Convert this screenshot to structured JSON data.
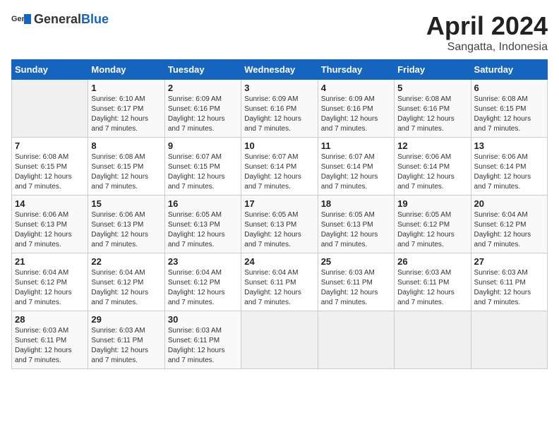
{
  "header": {
    "logo_general": "General",
    "logo_blue": "Blue",
    "month_title": "April 2024",
    "location": "Sangatta, Indonesia"
  },
  "calendar": {
    "days_of_week": [
      "Sunday",
      "Monday",
      "Tuesday",
      "Wednesday",
      "Thursday",
      "Friday",
      "Saturday"
    ],
    "weeks": [
      [
        {
          "day": null,
          "info": null
        },
        {
          "day": "1",
          "sunrise": "6:10 AM",
          "sunset": "6:17 PM",
          "daylight": "12 hours and 7 minutes."
        },
        {
          "day": "2",
          "sunrise": "6:09 AM",
          "sunset": "6:16 PM",
          "daylight": "12 hours and 7 minutes."
        },
        {
          "day": "3",
          "sunrise": "6:09 AM",
          "sunset": "6:16 PM",
          "daylight": "12 hours and 7 minutes."
        },
        {
          "day": "4",
          "sunrise": "6:09 AM",
          "sunset": "6:16 PM",
          "daylight": "12 hours and 7 minutes."
        },
        {
          "day": "5",
          "sunrise": "6:08 AM",
          "sunset": "6:16 PM",
          "daylight": "12 hours and 7 minutes."
        },
        {
          "day": "6",
          "sunrise": "6:08 AM",
          "sunset": "6:15 PM",
          "daylight": "12 hours and 7 minutes."
        }
      ],
      [
        {
          "day": "7",
          "sunrise": "6:08 AM",
          "sunset": "6:15 PM",
          "daylight": "12 hours and 7 minutes."
        },
        {
          "day": "8",
          "sunrise": "6:08 AM",
          "sunset": "6:15 PM",
          "daylight": "12 hours and 7 minutes."
        },
        {
          "day": "9",
          "sunrise": "6:07 AM",
          "sunset": "6:15 PM",
          "daylight": "12 hours and 7 minutes."
        },
        {
          "day": "10",
          "sunrise": "6:07 AM",
          "sunset": "6:14 PM",
          "daylight": "12 hours and 7 minutes."
        },
        {
          "day": "11",
          "sunrise": "6:07 AM",
          "sunset": "6:14 PM",
          "daylight": "12 hours and 7 minutes."
        },
        {
          "day": "12",
          "sunrise": "6:06 AM",
          "sunset": "6:14 PM",
          "daylight": "12 hours and 7 minutes."
        },
        {
          "day": "13",
          "sunrise": "6:06 AM",
          "sunset": "6:14 PM",
          "daylight": "12 hours and 7 minutes."
        }
      ],
      [
        {
          "day": "14",
          "sunrise": "6:06 AM",
          "sunset": "6:13 PM",
          "daylight": "12 hours and 7 minutes."
        },
        {
          "day": "15",
          "sunrise": "6:06 AM",
          "sunset": "6:13 PM",
          "daylight": "12 hours and 7 minutes."
        },
        {
          "day": "16",
          "sunrise": "6:05 AM",
          "sunset": "6:13 PM",
          "daylight": "12 hours and 7 minutes."
        },
        {
          "day": "17",
          "sunrise": "6:05 AM",
          "sunset": "6:13 PM",
          "daylight": "12 hours and 7 minutes."
        },
        {
          "day": "18",
          "sunrise": "6:05 AM",
          "sunset": "6:13 PM",
          "daylight": "12 hours and 7 minutes."
        },
        {
          "day": "19",
          "sunrise": "6:05 AM",
          "sunset": "6:12 PM",
          "daylight": "12 hours and 7 minutes."
        },
        {
          "day": "20",
          "sunrise": "6:04 AM",
          "sunset": "6:12 PM",
          "daylight": "12 hours and 7 minutes."
        }
      ],
      [
        {
          "day": "21",
          "sunrise": "6:04 AM",
          "sunset": "6:12 PM",
          "daylight": "12 hours and 7 minutes."
        },
        {
          "day": "22",
          "sunrise": "6:04 AM",
          "sunset": "6:12 PM",
          "daylight": "12 hours and 7 minutes."
        },
        {
          "day": "23",
          "sunrise": "6:04 AM",
          "sunset": "6:12 PM",
          "daylight": "12 hours and 7 minutes."
        },
        {
          "day": "24",
          "sunrise": "6:04 AM",
          "sunset": "6:11 PM",
          "daylight": "12 hours and 7 minutes."
        },
        {
          "day": "25",
          "sunrise": "6:03 AM",
          "sunset": "6:11 PM",
          "daylight": "12 hours and 7 minutes."
        },
        {
          "day": "26",
          "sunrise": "6:03 AM",
          "sunset": "6:11 PM",
          "daylight": "12 hours and 7 minutes."
        },
        {
          "day": "27",
          "sunrise": "6:03 AM",
          "sunset": "6:11 PM",
          "daylight": "12 hours and 7 minutes."
        }
      ],
      [
        {
          "day": "28",
          "sunrise": "6:03 AM",
          "sunset": "6:11 PM",
          "daylight": "12 hours and 7 minutes."
        },
        {
          "day": "29",
          "sunrise": "6:03 AM",
          "sunset": "6:11 PM",
          "daylight": "12 hours and 7 minutes."
        },
        {
          "day": "30",
          "sunrise": "6:03 AM",
          "sunset": "6:11 PM",
          "daylight": "12 hours and 7 minutes."
        },
        {
          "day": null,
          "info": null
        },
        {
          "day": null,
          "info": null
        },
        {
          "day": null,
          "info": null
        },
        {
          "day": null,
          "info": null
        }
      ]
    ]
  }
}
